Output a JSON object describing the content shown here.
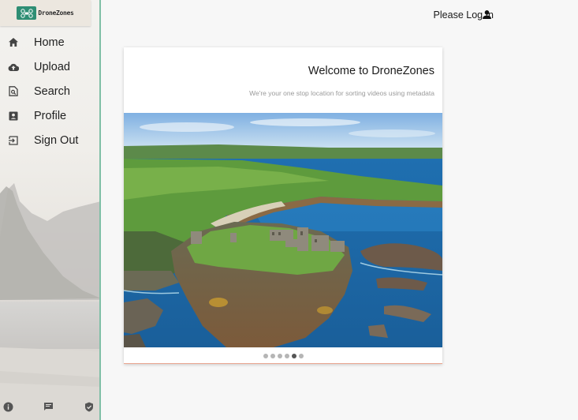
{
  "logo": {
    "text": "DroneZones",
    "icon": "drone-logo-icon"
  },
  "nav": {
    "items": [
      {
        "label": "Home",
        "icon": "home-icon"
      },
      {
        "label": "Upload",
        "icon": "cloud-upload-icon"
      },
      {
        "label": "Search",
        "icon": "search-file-icon"
      },
      {
        "label": "Profile",
        "icon": "profile-card-icon"
      },
      {
        "label": "Sign Out",
        "icon": "sign-out-icon"
      }
    ]
  },
  "footer": {
    "icons": [
      "info-icon",
      "feedback-icon",
      "verified-shield-icon"
    ]
  },
  "header": {
    "login_label": "Please Log In",
    "user_icon": "account-icon"
  },
  "card": {
    "title": "Welcome to DroneZones",
    "subtitle": "We're your one stop location for sorting videos using metadata"
  },
  "carousel": {
    "slide_count": 6,
    "active_index": 4
  },
  "colors": {
    "accent": "#2e8e74",
    "sidebar_border": "#7fbfa6",
    "card_bottom_border": "#e9a58f"
  }
}
